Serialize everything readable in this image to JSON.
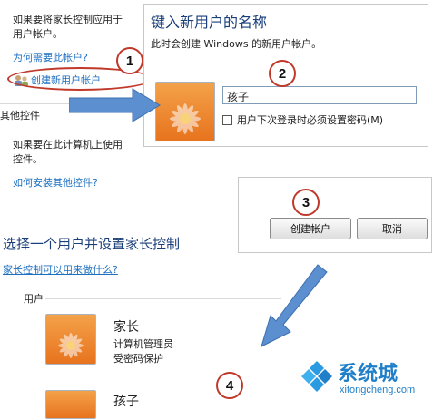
{
  "left": {
    "intro_line1": "如果要将家长控制应用于",
    "intro_line2": "用户帐户。",
    "why_need_account_link": "为何需要此帐户?",
    "create_account_link": "创建新用户帐户",
    "other_controls_heading": "其他控件",
    "other_controls_line1": "如果要在此计算机上使用",
    "other_controls_line2": "控件。",
    "install_other_controls_link": "如何安装其他控件?",
    "choose_user_heading": "选择一个用户并设置家长控制",
    "what_parental_link": "家长控制可以用来做什么?",
    "users_section_label": "用户",
    "user1_name": "家长",
    "user1_role": "计算机管理员",
    "user1_password": "受密码保护",
    "user2_name": "孩子"
  },
  "dialog": {
    "title": "键入新用户的名称",
    "subtitle": "此时会创建 Windows 的新用户帐户。",
    "name_value": "孩子",
    "require_password_label": "用户下次登录时必须设置密码(M)"
  },
  "buttons": {
    "create_account": "创建帐户",
    "cancel": "取消"
  },
  "steps": [
    "1",
    "2",
    "3",
    "4"
  ],
  "watermark": {
    "brand": "系统城",
    "url": "xitongcheng.com"
  },
  "colors": {
    "link": "#1d6fc0",
    "annotation_red": "#c0392b",
    "arrow_blue": "#5b8fd0"
  }
}
